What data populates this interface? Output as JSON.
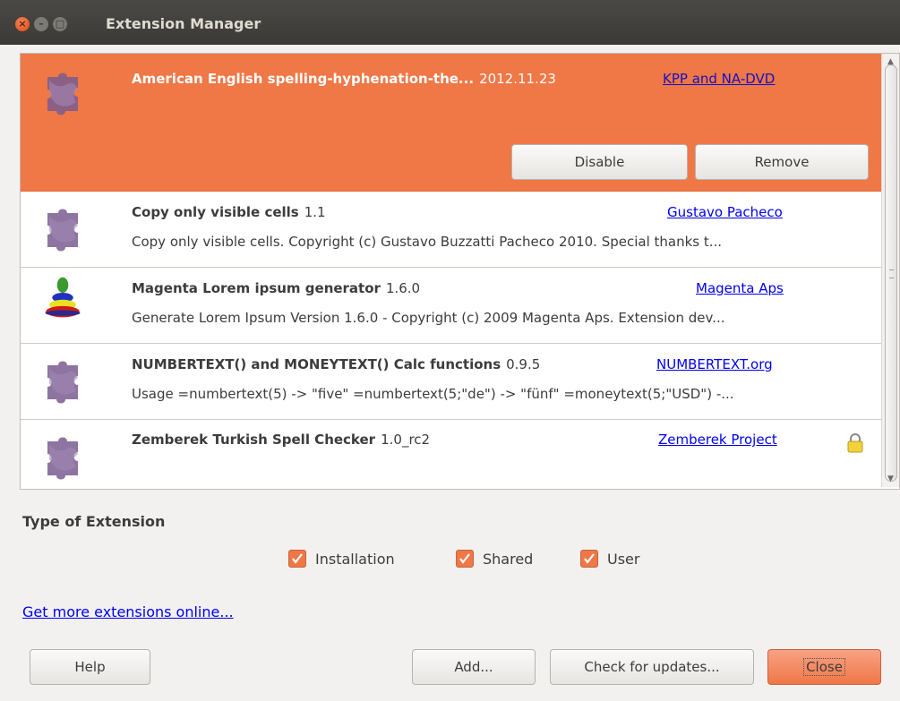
{
  "window": {
    "title": "Extension Manager",
    "buttons": [
      "close",
      "minimize",
      "maximize"
    ]
  },
  "extensions": [
    {
      "name": "American English spelling-hyphenation-the...",
      "version": "2012.11.23",
      "publisher": "KPP and NA-DVD",
      "description": "",
      "selected": true,
      "icon": "puzzle-icon",
      "buttons": {
        "disable": "Disable",
        "remove": "Remove"
      }
    },
    {
      "name": "Copy only visible cells",
      "version": "1.1",
      "publisher": "Gustavo Pacheco",
      "description": "Copy only visible cells. Copyright (c) Gustavo Buzzatti Pacheco 2010. Special thanks t...",
      "icon": "puzzle-icon"
    },
    {
      "name": "Magenta Lorem ipsum generator",
      "version": "1.6.0",
      "publisher": "Magenta Aps",
      "description": "Generate Lorem Ipsum Version 1.6.0 - Copyright (c) 2009 Magenta Aps. Extension dev...",
      "icon": "stacking-rings-icon"
    },
    {
      "name": "NUMBERTEXT() and MONEYTEXT() Calc functions",
      "version": "0.9.5",
      "publisher": "NUMBERTEXT.org",
      "description": "Usage  =numbertext(5) -> \"five\" =numbertext(5;\"de\") -> \"fünf\" =moneytext(5;\"USD\") -...",
      "icon": "puzzle-icon"
    },
    {
      "name": "Zemberek Turkish Spell Checker",
      "version": "1.0_rc2",
      "publisher": "Zemberek Project",
      "description": "",
      "icon": "puzzle-icon",
      "locked": true
    }
  ],
  "type_section": {
    "title": "Type of Extension",
    "options": [
      {
        "label": "Installation",
        "checked": true
      },
      {
        "label": "Shared",
        "checked": true
      },
      {
        "label": "User",
        "checked": true
      }
    ]
  },
  "online_link": "Get more extensions online...",
  "footer": {
    "help": "Help",
    "add": "Add...",
    "check_updates": "Check for updates...",
    "close": "Close"
  },
  "colors": {
    "accent": "#f07746",
    "titlebar": "#3c3b37",
    "link": "#0000ee",
    "puzzle": "#7a5c8f"
  }
}
